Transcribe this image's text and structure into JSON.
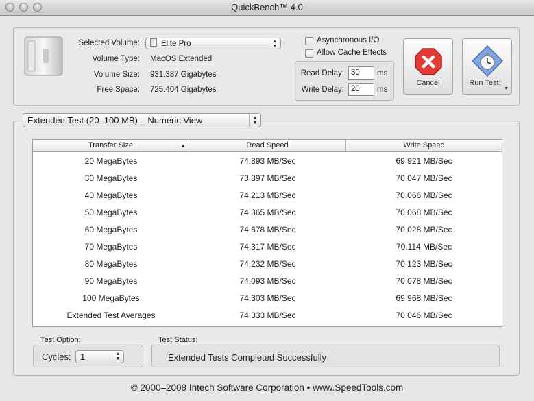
{
  "window": {
    "title": "QuickBench™ 4.0"
  },
  "volume": {
    "selected_label": "Selected Volume:",
    "selected_value": "Elite Pro",
    "type_label": "Volume Type:",
    "type_value": "MacOS Extended",
    "size_label": "Volume Size:",
    "size_value": "931.387 Gigabytes",
    "free_label": "Free Space:",
    "free_value": "725.404 Gigabytes"
  },
  "options": {
    "async_label": "Asynchronous I/O",
    "async_checked": false,
    "cache_label": "Allow Cache Effects",
    "cache_checked": false,
    "read_delay_label": "Read Delay:",
    "read_delay_value": "30",
    "read_delay_unit": "ms",
    "write_delay_label": "Write Delay:",
    "write_delay_value": "20",
    "write_delay_unit": "ms"
  },
  "buttons": {
    "cancel_label": "Cancel",
    "run_label": "Run Test:"
  },
  "view": {
    "selected": "Extended Test (20–100 MB) – Numeric View"
  },
  "table": {
    "columns": [
      "Transfer Size",
      "Read Speed",
      "Write Speed"
    ],
    "rows": [
      [
        "20 MegaBytes",
        "74.893 MB/Sec",
        "69.921 MB/Sec"
      ],
      [
        "30 MegaBytes",
        "73.897 MB/Sec",
        "70.047 MB/Sec"
      ],
      [
        "40 MegaBytes",
        "74.213 MB/Sec",
        "70.066 MB/Sec"
      ],
      [
        "50 MegaBytes",
        "74.365 MB/Sec",
        "70.068 MB/Sec"
      ],
      [
        "60 MegaBytes",
        "74.678 MB/Sec",
        "70.028 MB/Sec"
      ],
      [
        "70 MegaBytes",
        "74.317 MB/Sec",
        "70.114 MB/Sec"
      ],
      [
        "80 MegaBytes",
        "74.232 MB/Sec",
        "70.123 MB/Sec"
      ],
      [
        "90 MegaBytes",
        "74.093 MB/Sec",
        "70.078 MB/Sec"
      ],
      [
        "100 MegaBytes",
        "74.303 MB/Sec",
        "69.968 MB/Sec"
      ],
      [
        "Extended Test Averages",
        "74.333 MB/Sec",
        "70.046 MB/Sec"
      ]
    ]
  },
  "test_option": {
    "label": "Test Option:",
    "cycles_label": "Cycles:",
    "cycles_value": "1"
  },
  "test_status": {
    "label": "Test Status:",
    "message": "Extended Tests Completed Successfully"
  },
  "footer": {
    "text": "© 2000–2008 Intech Software Corporation • www.SpeedTools.com"
  },
  "colors": {
    "cancel_red": "#e23a34",
    "run_blue": "#7fa6e0"
  }
}
